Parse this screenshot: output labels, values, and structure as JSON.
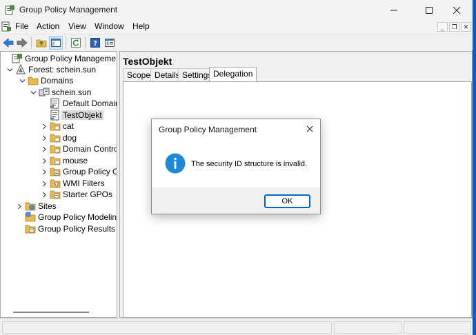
{
  "window": {
    "title": "Group Policy Management"
  },
  "menu": {
    "items": [
      "File",
      "Action",
      "View",
      "Window",
      "Help"
    ]
  },
  "toolbar": {
    "buttons": [
      "back-arrow-icon",
      "forward-arrow-icon",
      "up-folder-icon",
      "show-hide-tree-icon",
      "refresh-icon",
      "help-icon",
      "properties-icon"
    ]
  },
  "tree": {
    "items": [
      {
        "label": "Group Policy Management",
        "icon": "gpm-icon",
        "twisty": ""
      },
      {
        "label": "Forest: schein.sun",
        "icon": "forest-icon",
        "twisty": "expanded"
      },
      {
        "label": "Domains",
        "icon": "folder-icon",
        "twisty": "expanded"
      },
      {
        "label": "schein.sun",
        "icon": "domain-icon",
        "twisty": "expanded"
      },
      {
        "label": "Default Domain",
        "icon": "gpo-link-icon",
        "twisty": ""
      },
      {
        "label": "TestObjekt",
        "icon": "gpo-link-icon",
        "twisty": "",
        "selected": true
      },
      {
        "label": "cat",
        "icon": "ou-folder-icon",
        "twisty": "collapsed"
      },
      {
        "label": "dog",
        "icon": "ou-folder-icon",
        "twisty": "collapsed"
      },
      {
        "label": "Domain Contro",
        "icon": "ou-folder-icon",
        "twisty": "collapsed"
      },
      {
        "label": "mouse",
        "icon": "ou-folder-icon",
        "twisty": "collapsed"
      },
      {
        "label": "Group Policy Ol",
        "icon": "gpo-folder-icon",
        "twisty": "collapsed"
      },
      {
        "label": "WMI Filters",
        "icon": "wmi-folder-icon",
        "twisty": "collapsed"
      },
      {
        "label": "Starter GPOs",
        "icon": "starter-folder-icon",
        "twisty": "collapsed"
      },
      {
        "label": "Sites",
        "icon": "sites-icon",
        "twisty": "collapsed"
      },
      {
        "label": "Group Policy Modeling",
        "icon": "modeling-icon",
        "twisty": ""
      },
      {
        "label": "Group Policy Results",
        "icon": "results-icon",
        "twisty": ""
      }
    ]
  },
  "details": {
    "title": "TestObjekt",
    "tabs": [
      "Scope",
      "Details",
      "Settings",
      "Delegation"
    ],
    "active_tab": "Delegation"
  },
  "dialog": {
    "title": "Group Policy Management",
    "message": "The security ID structure is invalid.",
    "ok_label": "OK",
    "icon": "info-icon"
  },
  "colors": {
    "accent": "#0067c0",
    "info_icon": "#1e88d8",
    "folder": "#e8b84a",
    "desktop": "#0f58c8"
  }
}
